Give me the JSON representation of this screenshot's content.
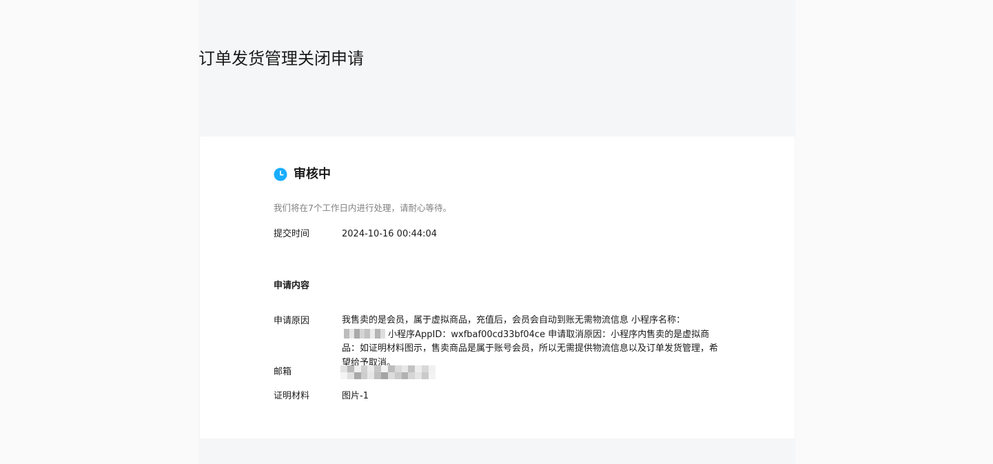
{
  "page": {
    "title": "订单发货管理关闭申请"
  },
  "status": {
    "icon": "clock-icon",
    "title": "审核中",
    "description": "我们将在7个工作日内进行处理，请耐心等待。",
    "color": "#1aadff"
  },
  "submit": {
    "label": "提交时间",
    "value": "2024-10-16 00:44:04"
  },
  "application": {
    "section_title": "申请内容",
    "reason_label": "申请原因",
    "reason_part1": "我售卖的是会员，属于虚拟商品，充值后，会员会自动到账无需物流信息 小程序名称：",
    "reason_part2": " 小程序AppID：wxfbaf00cd33bf04ce 申请取消原因：小程序内售卖的是虚拟商品：如证明材料图示，售卖商品是属于账号会员，所以无需提供物流信息以及订单发货管理，希望给予取消。",
    "email_label": "邮箱",
    "proof_label": "证明材料",
    "proof_value": "图片-1"
  }
}
